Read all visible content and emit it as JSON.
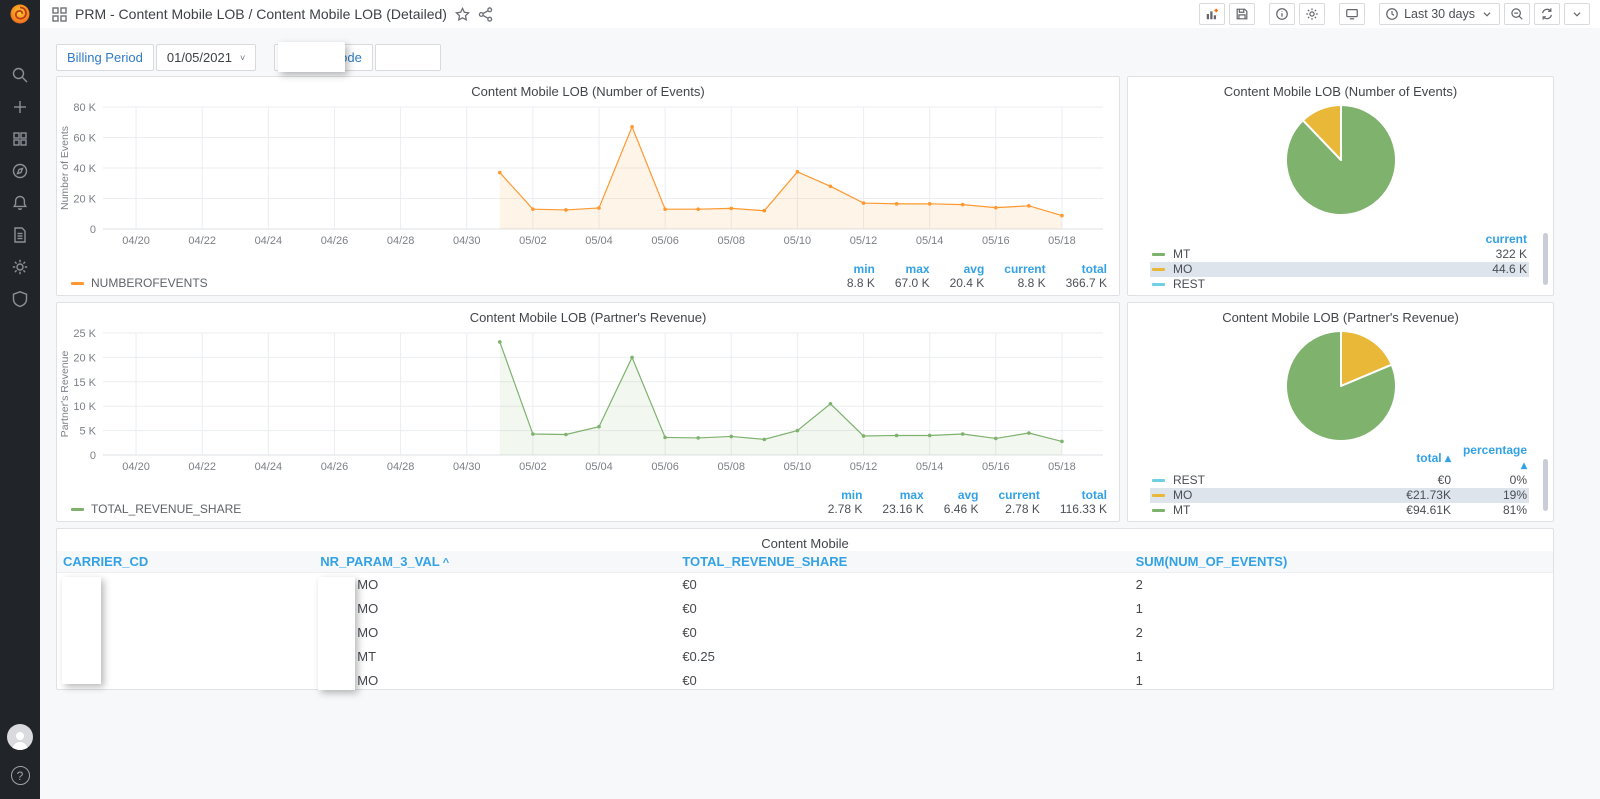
{
  "nav": {
    "title": "PRM - Content Mobile LOB / Content Mobile LOB (Detailed)",
    "time_range": "Last 30 days"
  },
  "filters": {
    "billing_period_label": "Billing Period",
    "billing_period_value": "01/05/2021",
    "partner_code_label": "Partnet Code"
  },
  "colors": {
    "orange": "#ff9830",
    "green": "#7eb26d",
    "yellow": "#eab839",
    "cyan": "#6ed0e0",
    "header_blue": "#33a2e5"
  },
  "chart_data": [
    {
      "type": "line",
      "title": "Content Mobile LOB (Number of Events)",
      "ylabel": "Number of Events",
      "x_tick_labels": [
        "04/20",
        "04/22",
        "04/24",
        "04/26",
        "04/28",
        "04/30",
        "05/02",
        "05/04",
        "05/06",
        "05/08",
        "05/10",
        "05/12",
        "05/14",
        "05/16",
        "05/18"
      ],
      "x_tick_days": [
        1,
        3,
        5,
        7,
        9,
        11,
        13,
        15,
        17,
        19,
        21,
        23,
        25,
        27,
        29
      ],
      "x_domain_days": 30,
      "ylim": [
        0,
        80000
      ],
      "y_ticks": [
        0,
        20000,
        40000,
        60000,
        80000
      ],
      "y_tick_labels": [
        "0",
        "20 K",
        "40 K",
        "60 K",
        "80 K"
      ],
      "series": [
        {
          "name": "NUMBEROFEVENTS",
          "color": "#ff9830",
          "fill": "rgba(255,152,48,0.11)",
          "start_day": 12,
          "dates": [
            "05/01",
            "05/02",
            "05/03",
            "05/04",
            "05/05",
            "05/06",
            "05/07",
            "05/08",
            "05/09",
            "05/10",
            "05/11",
            "05/12",
            "05/13",
            "05/14",
            "05/15",
            "05/16",
            "05/17",
            "05/18"
          ],
          "values": [
            37000,
            13000,
            12500,
            13800,
            67000,
            13000,
            13000,
            13500,
            12000,
            37500,
            28000,
            17000,
            16500,
            16500,
            16000,
            14000,
            15200,
            8800
          ]
        }
      ],
      "stats": {
        "headers": [
          "min",
          "max",
          "avg",
          "current",
          "total"
        ],
        "values": [
          "8.8 K",
          "67.0 K",
          "20.4 K",
          "8.8 K",
          "366.7 K"
        ]
      }
    },
    {
      "type": "pie",
      "title": "Content Mobile LOB (Number of Events)",
      "legend_columns": [
        {
          "label": "current",
          "sorted": false
        }
      ],
      "slices": [
        {
          "label": "MT",
          "color": "#7eb26d",
          "value": 322000,
          "display": [
            "322 K"
          ],
          "highlight": false
        },
        {
          "label": "MO",
          "color": "#eab839",
          "value": 44600,
          "display": [
            "44.6 K"
          ],
          "highlight": true
        },
        {
          "label": "REST",
          "color": "#6ed0e0",
          "value": 0,
          "display": [
            ""
          ],
          "highlight": false
        }
      ]
    },
    {
      "type": "line",
      "title": "Content Mobile LOB (Partner's Revenue)",
      "ylabel": "Partner's Revenue",
      "x_tick_labels": [
        "04/20",
        "04/22",
        "04/24",
        "04/26",
        "04/28",
        "04/30",
        "05/02",
        "05/04",
        "05/06",
        "05/08",
        "05/10",
        "05/12",
        "05/14",
        "05/16",
        "05/18"
      ],
      "x_tick_days": [
        1,
        3,
        5,
        7,
        9,
        11,
        13,
        15,
        17,
        19,
        21,
        23,
        25,
        27,
        29
      ],
      "x_domain_days": 30,
      "ylim": [
        0,
        25000
      ],
      "y_ticks": [
        0,
        5000,
        10000,
        15000,
        20000,
        25000
      ],
      "y_tick_labels": [
        "0",
        "5 K",
        "10 K",
        "15 K",
        "20 K",
        "25 K"
      ],
      "series": [
        {
          "name": "TOTAL_REVENUE_SHARE",
          "color": "#7eb26d",
          "fill": "rgba(126,178,109,0.10)",
          "start_day": 12,
          "dates": [
            "05/01",
            "05/02",
            "05/03",
            "05/04",
            "05/05",
            "05/06",
            "05/07",
            "05/08",
            "05/09",
            "05/10",
            "05/11",
            "05/12",
            "05/13",
            "05/14",
            "05/15",
            "05/16",
            "05/17",
            "05/18"
          ],
          "values": [
            23160,
            4300,
            4200,
            5800,
            20000,
            3600,
            3500,
            3800,
            3200,
            5000,
            10500,
            3900,
            4000,
            4000,
            4300,
            3400,
            4500,
            2780
          ]
        }
      ],
      "stats": {
        "headers": [
          "min",
          "max",
          "avg",
          "current",
          "total"
        ],
        "values": [
          "2.78 K",
          "23.16 K",
          "6.46 K",
          "2.78 K",
          "116.33 K"
        ]
      }
    },
    {
      "type": "pie",
      "title": "Content Mobile LOB (Partner's Revenue)",
      "legend_columns": [
        {
          "label": "total",
          "sorted": true
        },
        {
          "label": "percentage",
          "sorted": true
        }
      ],
      "slices": [
        {
          "label": "REST",
          "color": "#6ed0e0",
          "value": 0,
          "display": [
            "€0",
            "0%"
          ],
          "highlight": false
        },
        {
          "label": "MO",
          "color": "#eab839",
          "value": 21730,
          "display": [
            "€21.73K",
            "19%"
          ],
          "highlight": true
        },
        {
          "label": "MT",
          "color": "#7eb26d",
          "value": 94610,
          "display": [
            "€94.61K",
            "81%"
          ],
          "highlight": false
        }
      ]
    },
    {
      "type": "table",
      "title": "Content Mobile",
      "columns": [
        {
          "label": "CARRIER_CD",
          "sorted": false
        },
        {
          "label": "NR_PARAM_3_VAL",
          "sorted": true
        },
        {
          "label": "TOTAL_REVENUE_SHARE",
          "sorted": false
        },
        {
          "label": "SUM(NUM_OF_EVENTS)",
          "sorted": false
        }
      ],
      "rows": [
        [
          "",
          "MO",
          "€0",
          "2"
        ],
        [
          "",
          "MO",
          "€0",
          "1"
        ],
        [
          "",
          "MO",
          "€0",
          "2"
        ],
        [
          "",
          "MT",
          "€0.25",
          "1"
        ],
        [
          "",
          "MO",
          "€0",
          "1"
        ]
      ]
    }
  ]
}
